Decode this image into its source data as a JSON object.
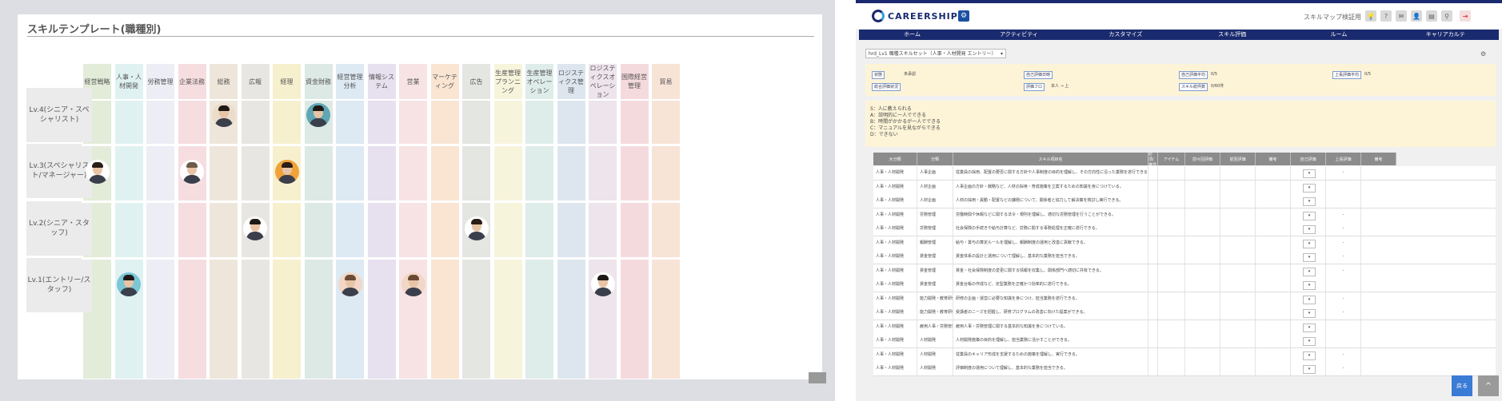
{
  "left": {
    "title": "スキルテンプレート(職種別)",
    "columns": [
      {
        "label": "経営戦略",
        "color": "#e3ecd8"
      },
      {
        "label": "人事・人材開発",
        "color": "#dff2f1"
      },
      {
        "label": "労務管理",
        "color": "#ecedf5"
      },
      {
        "label": "企業法務",
        "color": "#f6dde0"
      },
      {
        "label": "総務",
        "color": "#efe6db"
      },
      {
        "label": "広報",
        "color": "#e8e6e2"
      },
      {
        "label": "経理",
        "color": "#f6f0ce"
      },
      {
        "label": "資金財務",
        "color": "#dde9e4"
      },
      {
        "label": "経営管理分析",
        "color": "#dde9f3"
      },
      {
        "label": "情報システム",
        "color": "#e6e0ef"
      },
      {
        "label": "営業",
        "color": "#f7e3e4"
      },
      {
        "label": "マーケティング",
        "color": "#f9e5d2"
      },
      {
        "label": "広告",
        "color": "#e4e6e1"
      },
      {
        "label": "生産管理プランニング",
        "color": "#f7f4dc"
      },
      {
        "label": "生産管理オペレーション",
        "color": "#deedea"
      },
      {
        "label": "ロジスティクス管理",
        "color": "#dde6ef"
      },
      {
        "label": "ロジスティクスオペレーション",
        "color": "#ede4ec"
      },
      {
        "label": "国際経営管理",
        "color": "#f5dadd"
      },
      {
        "label": "貿易",
        "color": "#f8e3d7"
      }
    ],
    "rows": [
      {
        "label": "Lv.4(シニア・スペシャリスト)"
      },
      {
        "label": "Lv.3(スペシャリスト/マネージャー)"
      },
      {
        "label": "Lv.2(シニア・スタッフ)"
      },
      {
        "label": "Lv.1(エントリー/スタッフ)"
      }
    ],
    "avatars": [
      {
        "row": 0,
        "col": 4,
        "bg": "#ecdccb",
        "hair": "#1f1915"
      },
      {
        "row": 0,
        "col": 7,
        "bg": "#5fa7b5",
        "hair": "#1f1915"
      },
      {
        "row": 1,
        "col": 0,
        "bg": "#ffffff",
        "hair": "#2a1e17"
      },
      {
        "row": 1,
        "col": 3,
        "bg": "#ffffff",
        "hair": "#6e5a48"
      },
      {
        "row": 1,
        "col": 6,
        "bg": "#f0a23a",
        "hair": "#2a1e17"
      },
      {
        "row": 2,
        "col": 5,
        "bg": "#ffffff",
        "hair": "#1f1915"
      },
      {
        "row": 2,
        "col": 12,
        "bg": "#ffffff",
        "hair": "#2a1e17"
      },
      {
        "row": 3,
        "col": 1,
        "bg": "#7cc6d6",
        "hair": "#1f1915"
      },
      {
        "row": 3,
        "col": 8,
        "bg": "#f2d7c7",
        "hair": "#6b4a33"
      },
      {
        "row": 3,
        "col": 10,
        "bg": "#f2d7c7",
        "hair": "#6b4a33"
      },
      {
        "row": 3,
        "col": 16,
        "bg": "#ffffff",
        "hair": "#1f1915"
      }
    ]
  },
  "right": {
    "logo_text": "CAREERSHIP",
    "skillmap_label": "スキルマップ検証用",
    "nav": [
      "ホーム",
      "アクティビティ",
      "カスタマイズ",
      "スキル評価",
      "ルーム",
      "キャリアカルテ"
    ],
    "select_value": "hrd_Lv1 職種スキルセット（人事・人材開発 エントリー）",
    "info": {
      "status_label": "状態",
      "status_value": "未承認",
      "self_eval_label": "自己評価日時",
      "self_eval_value": "",
      "grade_label": "自己評価平均",
      "grade_value": "0/5",
      "boss_label": "上長評価平均",
      "boss_value": "0/5",
      "comp_label": "総合評価状況",
      "comp_value": "",
      "eval_label": "評価フロ",
      "eval_value": "本人 → 上",
      "count_label": "スキル総件数",
      "count_value": "0/60件"
    },
    "legend": [
      "S：人に教えられる",
      "A：説明的に一人でできる",
      "B：時間がかかるが一人でできる",
      "C：マニュアルを見ながらできる",
      "D：できない"
    ],
    "table_headers": [
      "大分類",
      "分類",
      "スキル項目名",
      "必須/推奨",
      "アイテム",
      "前々回評価",
      "前回評価",
      "備考",
      "自己評価",
      "上長評価",
      "備考"
    ],
    "table_rows": [
      {
        "c1": "人事・人材開発",
        "c2": "人事企画",
        "c3": "従業員の採用、配置の要否に関する方針や人事制度の目的を理解し、その方向性に沿った業務を遂行できる。",
        "boss": "-"
      },
      {
        "c1": "人事・人材開発",
        "c2": "人材企画",
        "c3": "人事企画の方針・戦略など、人材の採用・育成施策を立案するための知識を身につけている。",
        "boss": ""
      },
      {
        "c1": "人事・人材開発",
        "c2": "人材企画",
        "c3": "人材の採用・異動・配置などの課題について、関係者と協力して解決策を検討し実行できる。",
        "boss": ""
      },
      {
        "c1": "人事・人材開発",
        "c2": "労務管理",
        "c3": "労働時間や休暇などに関する法令・規則を理解し、適切な労務管理を行うことができる。",
        "boss": "-"
      },
      {
        "c1": "人事・人材開発",
        "c2": "労務管理",
        "c3": "社会保険の手続きや給与計算など、労務に関する事務処理を正確に遂行できる。",
        "boss": "-"
      },
      {
        "c1": "人事・人材開発",
        "c2": "報酬管理",
        "c3": "給与・賞与の算定ルールを理解し、報酬制度の運用と改善に貢献できる。",
        "boss": "-"
      },
      {
        "c1": "人事・人材開発",
        "c2": "賃金管理",
        "c3": "賃金体系の設計と運用について理解し、基本的な業務を担当できる。",
        "boss": "-"
      },
      {
        "c1": "人事・人材開発",
        "c2": "賃金管理",
        "c3": "賃金・社会保険制度の変更に関する情報を収集し、関係部門へ適切に共有できる。",
        "boss": "-"
      },
      {
        "c1": "人事・人材開発",
        "c2": "賃金管理",
        "c3": "賃金台帳の作成など、定型業務を正確かつ効率的に遂行できる。",
        "boss": ""
      },
      {
        "c1": "人事・人材開発",
        "c2": "能力開発・教育研修",
        "c3": "研修の企画・運営に必要な知識を身につけ、担当業務を遂行できる。",
        "boss": "-"
      },
      {
        "c1": "人事・人材開発",
        "c2": "能力開発・教育研修",
        "c3": "受講者のニーズを把握し、研修プログラムの改善に向けた提案ができる。",
        "boss": "-"
      },
      {
        "c1": "人事・人材開発",
        "c2": "雇用人事・労務管理",
        "c3": "雇用人事・労務管理に関する基本的な知識を身につけている。",
        "boss": ""
      },
      {
        "c1": "人事・人材開発",
        "c2": "人材開発",
        "c3": "人材開発施策の目的を理解し、担当業務に活かすことができる。",
        "boss": ""
      },
      {
        "c1": "人事・人材開発",
        "c2": "人材開発",
        "c3": "従業員のキャリア形成を支援するための施策を理解し、実行できる。",
        "boss": "-"
      },
      {
        "c1": "人事・人材開発",
        "c2": "人材開発",
        "c3": "評価制度の運用について理解し、基本的な業務を担当できる。",
        "boss": "-"
      }
    ],
    "back_label": "戻る",
    "top_label": "^"
  }
}
